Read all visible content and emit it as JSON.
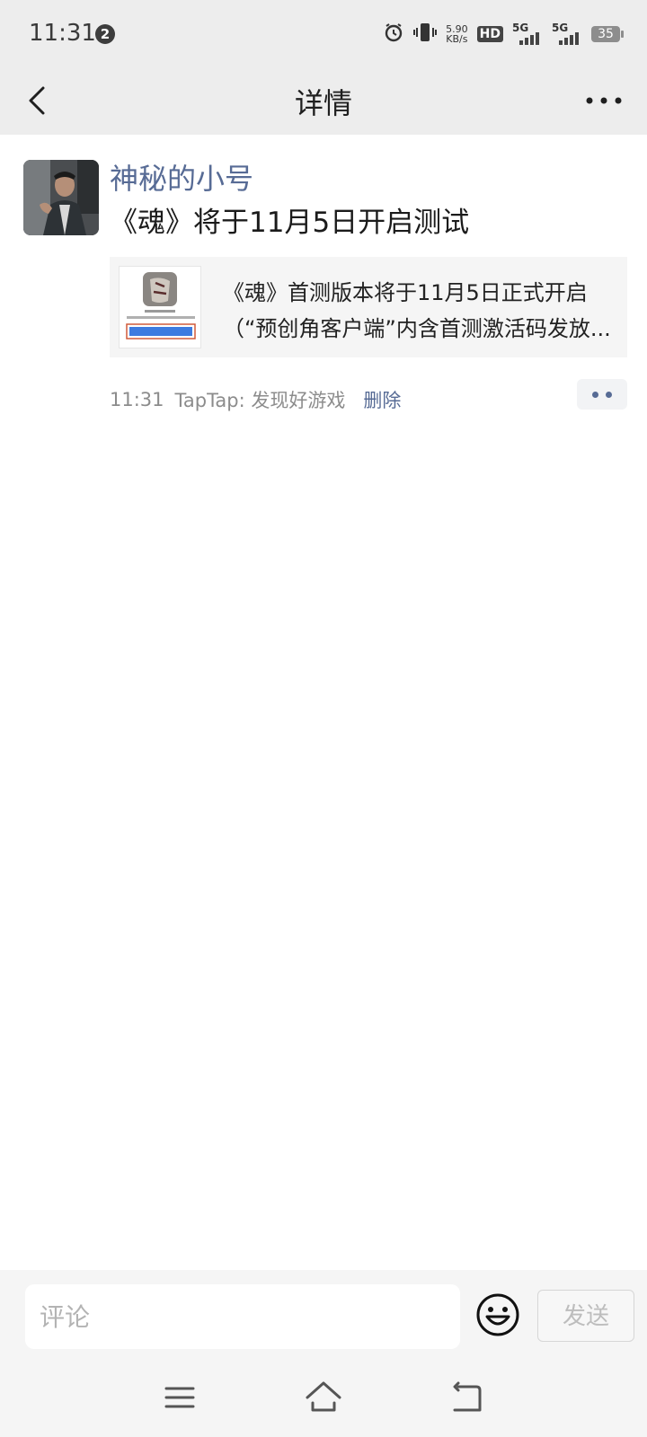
{
  "status_bar": {
    "time": "11:31",
    "notification_count": "2",
    "net_speed_value": "5.90",
    "net_speed_unit": "KB/s",
    "hd_label": "HD",
    "sim1_label": "5G",
    "sim2_label": "5G",
    "battery_level": "35"
  },
  "header": {
    "title": "详情"
  },
  "post": {
    "username": "神秘的小号",
    "text": "《魂》将于11月5日开启测试",
    "link_card": {
      "title": "《魂》首测版本将于11月5日正式开启",
      "description": "（“预创角客户端”内含首测激活码发放..."
    },
    "time": "11:31",
    "source": "TapTap: 发现好游戏",
    "delete_label": "删除"
  },
  "comment_bar": {
    "placeholder": "评论",
    "send_label": "发送"
  },
  "colors": {
    "link_blue": "#576b95",
    "bar_gray": "#ededed",
    "meta_gray": "#8c8c8c"
  }
}
